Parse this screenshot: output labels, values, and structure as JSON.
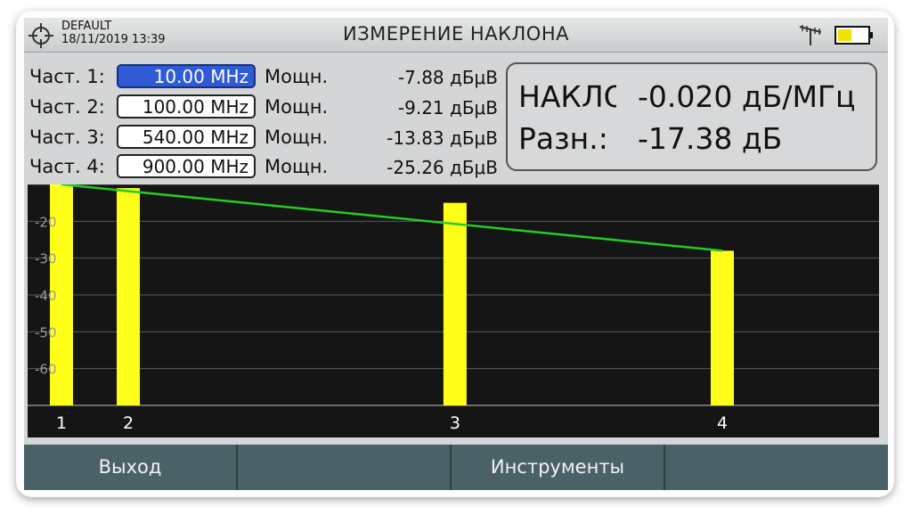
{
  "header": {
    "profile": "DEFAULT",
    "datetime": "18/11/2019 13:39",
    "title": "ИЗМЕРЕНИЕ НАКЛОНА"
  },
  "rows": [
    {
      "label": "Част. 1:",
      "freq": "10.00 MHz",
      "power_label": "Мощн.",
      "power": "-7.88 дБμВ",
      "selected": true
    },
    {
      "label": "Част. 2:",
      "freq": "100.00 MHz",
      "power_label": "Мощн.",
      "power": "-9.21 дБμВ",
      "selected": false
    },
    {
      "label": "Част. 3:",
      "freq": "540.00 MHz",
      "power_label": "Мощн.",
      "power": "-13.83 дБμВ",
      "selected": false
    },
    {
      "label": "Част. 4:",
      "freq": "900.00 MHz",
      "power_label": "Мощн.",
      "power": "-25.26 дБμВ",
      "selected": false
    }
  ],
  "result": {
    "tilt_label": "НАКЛОН",
    "tilt_value": "-0.020 дБ/МГц",
    "diff_label": "Разн.:",
    "diff_value": "-17.38 дБ"
  },
  "footer": {
    "exit": "Выход",
    "tools": "Инструменты"
  },
  "colors": {
    "bar": "#ffff1a",
    "line": "#22cc22",
    "selected": "#2f5bd6"
  },
  "chart_data": {
    "type": "bar",
    "categories": [
      "1",
      "2",
      "3",
      "4"
    ],
    "x": [
      10,
      100,
      540,
      900
    ],
    "values": [
      -10,
      -11,
      -15,
      -28
    ],
    "line_values": [
      -10,
      -28
    ],
    "yticks": [
      "-20",
      "-30",
      "-40",
      "-50",
      "-60"
    ],
    "ylim": [
      -70,
      -10
    ],
    "grid": true
  }
}
